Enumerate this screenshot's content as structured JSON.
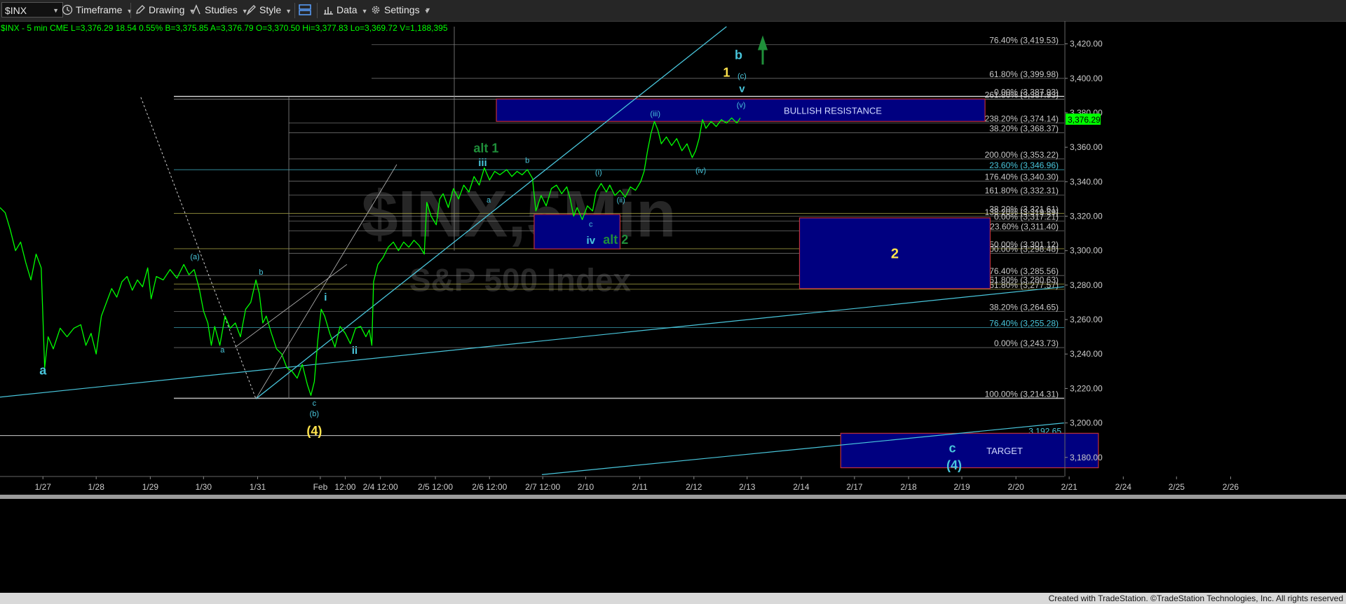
{
  "toolbar": {
    "symbol": "$INX",
    "timeframe": "Timeframe",
    "drawing": "Drawing",
    "studies": "Studies",
    "style": "Style",
    "data": "Data",
    "settings": "Settings"
  },
  "quote_line": "$INX - 5 min  CME  L=3,376.29  18.54  0.55%  B=3,375.85  A=3,376.79  O=3,370.50  Hi=3,377.83  Lo=3,369.72  V=1,188,395",
  "watermark": {
    "line1": "$INX,5Min",
    "line2": "S&P 500 Index"
  },
  "footer": "Created with TradeStation. ©TradeStation Technologies, Inc. All rights reserved",
  "colors": {
    "price": "#00ff00",
    "trendline": "#49c6dc",
    "box": "#000080",
    "box_border": "#c0303a",
    "wave_yellow": "#ffe34d",
    "wave_cyan": "#49c6dc",
    "wave_green": "#1f8f3a",
    "last_price_bg": "#00ff00"
  },
  "chart_data": {
    "type": "line",
    "title": "",
    "xlabel": "",
    "ylabel": "",
    "ylim": [
      3173,
      3430
    ],
    "xlim": [
      0,
      1500
    ],
    "grid": false,
    "y_ticks": [
      3180,
      3200,
      3220,
      3240,
      3260,
      3280,
      3300,
      3320,
      3340,
      3360,
      3380,
      3400,
      3420
    ],
    "y_tick_labels": [
      "3,180.00",
      "3,200.00",
      "3,220.00",
      "3,240.00",
      "3,260.00",
      "3,280.00",
      "3,300.00",
      "3,320.00",
      "3,340.00",
      "3,360.00",
      "3,380.00",
      "3,400.00",
      "3,420.00"
    ],
    "x_ticks": [
      {
        "x": 50,
        "label": "1/27"
      },
      {
        "x": 112,
        "label": "1/28"
      },
      {
        "x": 175,
        "label": "1/29"
      },
      {
        "x": 237,
        "label": "1/30"
      },
      {
        "x": 300,
        "label": "1/31"
      },
      {
        "x": 373,
        "label": "Feb"
      },
      {
        "x": 402,
        "label": "12:00"
      },
      {
        "x": 443,
        "label": "2/4 12:00"
      },
      {
        "x": 507,
        "label": "2/5 12:00"
      },
      {
        "x": 570,
        "label": "2/6 12:00"
      },
      {
        "x": 632,
        "label": "2/7 12:00"
      },
      {
        "x": 682,
        "label": "2/10"
      },
      {
        "x": 745,
        "label": "2/11"
      },
      {
        "x": 808,
        "label": "2/12"
      },
      {
        "x": 870,
        "label": "2/13"
      },
      {
        "x": 933,
        "label": "2/14"
      },
      {
        "x": 995,
        "label": "2/17"
      },
      {
        "x": 1058,
        "label": "2/18"
      },
      {
        "x": 1120,
        "label": "2/19"
      },
      {
        "x": 1183,
        "label": "2/20"
      },
      {
        "x": 1245,
        "label": "2/21"
      },
      {
        "x": 1308,
        "label": "2/24"
      },
      {
        "x": 1370,
        "label": "2/25"
      },
      {
        "x": 1433,
        "label": "2/26"
      }
    ],
    "last_price": {
      "label": "3,376.29",
      "value": 3376.29
    },
    "series": [
      {
        "values": [
          [
            0,
            3325
          ],
          [
            6,
            3322
          ],
          [
            12,
            3312
          ],
          [
            18,
            3300
          ],
          [
            24,
            3305
          ],
          [
            30,
            3293
          ],
          [
            36,
            3283
          ],
          [
            42,
            3298
          ],
          [
            48,
            3290
          ],
          [
            52,
            3232
          ],
          [
            56,
            3250
          ],
          [
            62,
            3243
          ],
          [
            70,
            3255
          ],
          [
            78,
            3250
          ],
          [
            86,
            3255
          ],
          [
            94,
            3257
          ],
          [
            100,
            3245
          ],
          [
            106,
            3252
          ],
          [
            112,
            3240
          ],
          [
            118,
            3262
          ],
          [
            124,
            3270
          ],
          [
            130,
            3278
          ],
          [
            136,
            3273
          ],
          [
            142,
            3282
          ],
          [
            148,
            3285
          ],
          [
            154,
            3277
          ],
          [
            160,
            3283
          ],
          [
            166,
            3279
          ],
          [
            172,
            3290
          ],
          [
            176,
            3272
          ],
          [
            182,
            3285
          ],
          [
            190,
            3283
          ],
          [
            198,
            3289
          ],
          [
            206,
            3284
          ],
          [
            214,
            3292
          ],
          [
            220,
            3286
          ],
          [
            226,
            3289
          ],
          [
            232,
            3278
          ],
          [
            237,
            3265
          ],
          [
            242,
            3258
          ],
          [
            246,
            3245
          ],
          [
            250,
            3256
          ],
          [
            256,
            3245
          ],
          [
            262,
            3262
          ],
          [
            268,
            3255
          ],
          [
            274,
            3258
          ],
          [
            280,
            3250
          ],
          [
            286,
            3266
          ],
          [
            292,
            3270
          ],
          [
            298,
            3283
          ],
          [
            302,
            3275
          ],
          [
            306,
            3258
          ],
          [
            310,
            3262
          ],
          [
            316,
            3252
          ],
          [
            322,
            3243
          ],
          [
            328,
            3240
          ],
          [
            334,
            3232
          ],
          [
            340,
            3230
          ],
          [
            346,
            3226
          ],
          [
            352,
            3234
          ],
          [
            358,
            3222
          ],
          [
            362,
            3216
          ],
          [
            366,
            3224
          ],
          [
            370,
            3248
          ],
          [
            374,
            3266
          ],
          [
            378,
            3262
          ],
          [
            384,
            3252
          ],
          [
            390,
            3244
          ],
          [
            396,
            3256
          ],
          [
            402,
            3252
          ],
          [
            408,
            3246
          ],
          [
            414,
            3255
          ],
          [
            420,
            3256
          ],
          [
            426,
            3250
          ],
          [
            430,
            3254
          ],
          [
            433,
            3245
          ],
          [
            435,
            3282
          ],
          [
            440,
            3292
          ],
          [
            446,
            3296
          ],
          [
            452,
            3302
          ],
          [
            458,
            3305
          ],
          [
            464,
            3300
          ],
          [
            470,
            3305
          ],
          [
            476,
            3302
          ],
          [
            482,
            3306
          ],
          [
            488,
            3303
          ],
          [
            494,
            3298
          ],
          [
            497,
            3328
          ],
          [
            502,
            3320
          ],
          [
            508,
            3315
          ],
          [
            512,
            3330
          ],
          [
            516,
            3333
          ],
          [
            522,
            3325
          ],
          [
            528,
            3336
          ],
          [
            534,
            3330
          ],
          [
            540,
            3338
          ],
          [
            546,
            3334
          ],
          [
            552,
            3343
          ],
          [
            558,
            3338
          ],
          [
            564,
            3348
          ],
          [
            570,
            3341
          ],
          [
            576,
            3346
          ],
          [
            582,
            3344
          ],
          [
            590,
            3347
          ],
          [
            596,
            3343
          ],
          [
            602,
            3346
          ],
          [
            608,
            3344
          ],
          [
            614,
            3347
          ],
          [
            620,
            3342
          ],
          [
            624,
            3323
          ],
          [
            630,
            3332
          ],
          [
            636,
            3326
          ],
          [
            642,
            3336
          ],
          [
            648,
            3338
          ],
          [
            654,
            3333
          ],
          [
            660,
            3337
          ],
          [
            664,
            3330
          ],
          [
            668,
            3320
          ],
          [
            672,
            3325
          ],
          [
            678,
            3318
          ],
          [
            684,
            3326
          ],
          [
            690,
            3323
          ],
          [
            694,
            3334
          ],
          [
            700,
            3339
          ],
          [
            706,
            3334
          ],
          [
            710,
            3338
          ],
          [
            716,
            3332
          ],
          [
            722,
            3335
          ],
          [
            728,
            3331
          ],
          [
            734,
            3337
          ],
          [
            740,
            3335
          ],
          [
            746,
            3340
          ],
          [
            750,
            3346
          ],
          [
            754,
            3358
          ],
          [
            758,
            3368
          ],
          [
            762,
            3375
          ],
          [
            766,
            3370
          ],
          [
            770,
            3362
          ],
          [
            776,
            3366
          ],
          [
            782,
            3361
          ],
          [
            788,
            3365
          ],
          [
            794,
            3358
          ],
          [
            800,
            3362
          ],
          [
            806,
            3354
          ],
          [
            810,
            3358
          ],
          [
            814,
            3365
          ],
          [
            818,
            3376
          ],
          [
            822,
            3371
          ],
          [
            828,
            3375
          ],
          [
            834,
            3372
          ],
          [
            840,
            3376
          ],
          [
            846,
            3374
          ],
          [
            852,
            3377
          ],
          [
            858,
            3374
          ],
          [
            862,
            3377
          ]
        ]
      }
    ],
    "fib_levels": [
      {
        "label": "76.40% (3,419.53)",
        "value": 3419.53
      },
      {
        "label": "61.80% (3,399.98)",
        "value": 3399.98
      },
      {
        "label": "261.80% (3,387.93)",
        "value": 3387.93
      },
      {
        "label": "0.00% (3,387.93)",
        "value": 3389.5
      },
      {
        "label": "238.20% (3,374.14)",
        "value": 3374.14
      },
      {
        "label": "38.20% (3,368.37)",
        "value": 3368.37
      },
      {
        "label": "200.00% (3,353.22)",
        "value": 3353.22
      },
      {
        "label": "23.60% (3,346.96)",
        "value": 3346.96
      },
      {
        "label": "176.40% (3,340.30)",
        "value": 3340.3
      },
      {
        "label": "161.80% (3,332.31)",
        "value": 3332.31
      },
      {
        "label": "38.20% (3,321.61)",
        "value": 3321.61
      },
      {
        "label": "138.20% (3,319.89)",
        "value": 3319.89
      },
      {
        "label": "0.00% (3,317.21)",
        "value": 3317.21
      },
      {
        "label": "123.60% (3,311.40)",
        "value": 3311.4
      },
      {
        "label": "50.00% (3,301.12)",
        "value": 3301.12
      },
      {
        "label": "100.00% (3,298.48)",
        "value": 3298.48
      },
      {
        "label": "76.40% (3,285.56)",
        "value": 3285.56
      },
      {
        "label": "61.80% (3,280.63)",
        "value": 3280.63
      },
      {
        "label": "61.80% (3,277.57)",
        "value": 3277.57
      },
      {
        "label": "38.20% (3,264.65)",
        "value": 3264.65
      },
      {
        "label": "76.40% (3,255.28)",
        "value": 3255.28
      },
      {
        "label": "0.00% (3,243.73)",
        "value": 3243.73
      },
      {
        "label": "100.00% (3,214.31)",
        "value": 3214.31
      }
    ],
    "price_label": {
      "label": "3,192.65",
      "value": 3192.65
    },
    "zones": [
      {
        "label": "BULLISH RESISTANCE",
        "x0": 578,
        "x1": 1147,
        "y_top": 3388,
        "y_bottom": 3375
      },
      {
        "label": "",
        "x0": 622,
        "x1": 722,
        "y_top": 3321,
        "y_bottom": 3301
      },
      {
        "label": "2",
        "x0": 931,
        "x1": 1153,
        "y_top": 3319,
        "y_bottom": 3278
      },
      {
        "label": "TARGET",
        "x0": 979,
        "x1": 1279,
        "y_top": 3194,
        "y_bottom": 3174
      }
    ],
    "wave_labels": [
      {
        "text": "a",
        "x": 50,
        "y": 3228,
        "color": "cyan",
        "size": "large"
      },
      {
        "text": "(a)",
        "x": 227,
        "y": 3295,
        "color": "cyan",
        "size": "small"
      },
      {
        "text": "b",
        "x": 304,
        "y": 3286,
        "color": "cyan",
        "size": "small"
      },
      {
        "text": "a",
        "x": 259,
        "y": 3241,
        "color": "cyan",
        "size": "small"
      },
      {
        "text": "i",
        "x": 379,
        "y": 3271,
        "color": "cyan",
        "size": "medium"
      },
      {
        "text": "ii",
        "x": 413,
        "y": 3240,
        "color": "cyan",
        "size": "medium"
      },
      {
        "text": "c",
        "x": 366,
        "y": 3210,
        "color": "cyan",
        "size": "small"
      },
      {
        "text": "(b)",
        "x": 366,
        "y": 3204,
        "color": "cyan",
        "size": "small"
      },
      {
        "text": "(4)",
        "x": 366,
        "y": 3193,
        "color": "yellow",
        "size": "large"
      },
      {
        "text": "alt 1",
        "x": 566,
        "y": 3357,
        "color": "green",
        "size": "large"
      },
      {
        "text": "iii",
        "x": 562,
        "y": 3349,
        "color": "cyan",
        "size": "medium"
      },
      {
        "text": "b",
        "x": 614,
        "y": 3351,
        "color": "cyan",
        "size": "small"
      },
      {
        "text": "a",
        "x": 569,
        "y": 3328,
        "color": "cyan",
        "size": "small"
      },
      {
        "text": "c",
        "x": 688,
        "y": 3314,
        "color": "cyan",
        "size": "small"
      },
      {
        "text": "iv",
        "x": 688,
        "y": 3304,
        "color": "cyan",
        "size": "medium"
      },
      {
        "text": "alt 2",
        "x": 717,
        "y": 3304,
        "color": "green",
        "size": "large"
      },
      {
        "text": "(i)",
        "x": 697,
        "y": 3344,
        "color": "cyan",
        "size": "small"
      },
      {
        "text": "(ii)",
        "x": 723,
        "y": 3328,
        "color": "cyan",
        "size": "small"
      },
      {
        "text": "(iii)",
        "x": 763,
        "y": 3378,
        "color": "cyan",
        "size": "small"
      },
      {
        "text": "(iv)",
        "x": 816,
        "y": 3345,
        "color": "cyan",
        "size": "small"
      },
      {
        "text": "1",
        "x": 846,
        "y": 3401,
        "color": "yellow",
        "size": "large"
      },
      {
        "text": "b",
        "x": 860,
        "y": 3411,
        "color": "cyan",
        "size": "large"
      },
      {
        "text": "(c)",
        "x": 864,
        "y": 3400,
        "color": "cyan",
        "size": "small"
      },
      {
        "text": "v",
        "x": 864,
        "y": 3392,
        "color": "cyan",
        "size": "medium"
      },
      {
        "text": "(v)",
        "x": 863,
        "y": 3383,
        "color": "cyan",
        "size": "small"
      },
      {
        "text": "c",
        "x": 1109,
        "y": 3183,
        "color": "cyan",
        "size": "large"
      },
      {
        "text": "(4)",
        "x": 1111,
        "y": 3173,
        "color": "cyan",
        "size": "large"
      }
    ]
  }
}
